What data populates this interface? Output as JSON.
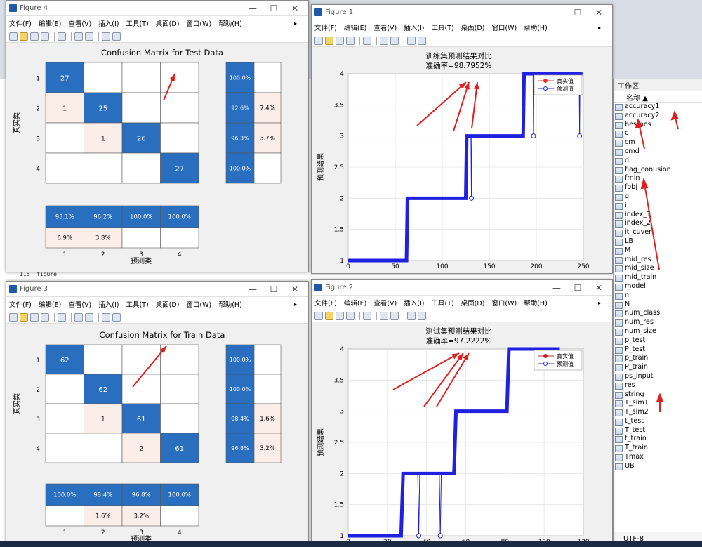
{
  "menu_cn": [
    "文件(F)",
    "编辑(E)",
    "查看(V)",
    "插入(I)",
    "工具(T)",
    "桌面(D)",
    "窗口(W)",
    "帮助(H)"
  ],
  "fig4": {
    "title": "Figure 4",
    "heading": "Confusion Matrix for Test Data",
    "ylabel": "真实类",
    "xlabel": "预测类",
    "rows": [
      "1",
      "2",
      "3",
      "4"
    ],
    "cols": [
      "1",
      "2",
      "3",
      "4"
    ],
    "cells": [
      [
        "27",
        "",
        "",
        ""
      ],
      [
        "1",
        "25",
        "",
        ""
      ],
      [
        "",
        "1",
        "26",
        ""
      ],
      [
        "",
        "",
        "",
        "27"
      ]
    ],
    "row_summary": [
      [
        "100.0%",
        ""
      ],
      [
        "92.6%",
        "7.4%"
      ],
      [
        "96.3%",
        "3.7%"
      ],
      [
        "100.0%",
        ""
      ]
    ],
    "col_summary_top": [
      "93.1%",
      "96.2%",
      "100.0%",
      "100.0%"
    ],
    "col_summary_bot": [
      "6.9%",
      "3.8%",
      "",
      ""
    ]
  },
  "fig3": {
    "title": "Figure 3",
    "heading": "Confusion Matrix for Train Data",
    "ylabel": "真实类",
    "xlabel": "预测类",
    "rows": [
      "1",
      "2",
      "3",
      "4"
    ],
    "cols": [
      "1",
      "2",
      "3",
      "4"
    ],
    "cells": [
      [
        "62",
        "",
        "",
        ""
      ],
      [
        "",
        "62",
        "",
        ""
      ],
      [
        "",
        "1",
        "61",
        ""
      ],
      [
        "",
        "",
        "2",
        "61"
      ]
    ],
    "row_summary": [
      [
        "100.0%",
        ""
      ],
      [
        "100.0%",
        ""
      ],
      [
        "98.4%",
        "1.6%"
      ],
      [
        "96.8%",
        "3.2%"
      ]
    ],
    "col_summary_top": [
      "100.0%",
      "98.4%",
      "96.8%",
      "100.0%"
    ],
    "col_summary_bot": [
      "",
      "1.6%",
      "3.2%",
      ""
    ]
  },
  "fig1": {
    "title": "Figure 1",
    "chart_data": {
      "type": "line",
      "title": "训练集预测结果对比",
      "subtitle": "准确率=98.7952%",
      "ylabel": "预测结果",
      "xlim": [
        0,
        250
      ],
      "ylim": [
        1,
        4
      ],
      "xticks": [
        0,
        50,
        100,
        150,
        200,
        250
      ],
      "yticks": [
        1,
        1.5,
        2,
        2.5,
        3,
        3.5,
        4
      ],
      "series": [
        {
          "name": "真实值",
          "color": "#e83030",
          "segments": [
            [
              0,
              62,
              1
            ],
            [
              63,
              125,
              2
            ],
            [
              126,
              186,
              3
            ],
            [
              187,
              249,
              4
            ]
          ]
        },
        {
          "name": "预测值",
          "color": "#2020e0",
          "segments": [
            [
              0,
              62,
              1
            ],
            [
              63,
              125,
              2
            ],
            [
              126,
              186,
              3
            ],
            [
              187,
              249,
              4
            ]
          ],
          "outliers": [
            [
              131,
              2
            ],
            [
              197,
              3
            ],
            [
              246,
              3
            ]
          ]
        }
      ]
    }
  },
  "fig2": {
    "title": "Figure 2",
    "menu": [
      "文件(F)",
      "编辑(E)",
      "查看(V)",
      "插入(I)",
      "工具(T)",
      "桌面(D)",
      "窗口(W)",
      "帮助(H)"
    ],
    "chart_data": {
      "type": "line",
      "title": "测试集预测结果对比",
      "subtitle": "准确率=97.2222%",
      "ylabel": "预测结果",
      "xlim": [
        0,
        120
      ],
      "ylim": [
        1,
        4
      ],
      "xticks": [
        0,
        20,
        40,
        60,
        80,
        100,
        120
      ],
      "yticks": [
        1,
        1.5,
        2,
        2.5,
        3,
        3.5,
        4
      ],
      "series": [
        {
          "name": "真实值",
          "color": "#c02828",
          "segments": [
            [
              0,
              27,
              1
            ],
            [
              28,
              54,
              2
            ],
            [
              55,
              81,
              3
            ],
            [
              82,
              108,
              4
            ]
          ]
        },
        {
          "name": "预测值",
          "color": "#2020e0",
          "segments": [
            [
              0,
              27,
              1
            ],
            [
              28,
              54,
              2
            ],
            [
              55,
              81,
              3
            ],
            [
              82,
              108,
              4
            ]
          ],
          "outliers": [
            [
              36,
              1
            ],
            [
              47,
              1
            ]
          ]
        }
      ]
    }
  },
  "workspace": {
    "header": "工作区",
    "col": "名称 ▲",
    "vars": [
      "accuracy1",
      "accuracy2",
      "bestpos",
      "c",
      "cm",
      "cmd",
      "d",
      "flag_conusion",
      "fmin",
      "fobj",
      "g",
      "i",
      "index_1",
      "index_2",
      "it_cuver",
      "LB",
      "M",
      "mid_res",
      "mid_size",
      "mid_train",
      "model",
      "n",
      "N",
      "num_class",
      "num_res",
      "num_size",
      "p_test",
      "P_test",
      "p_train",
      "P_train",
      "ps_input",
      "res",
      "string",
      "T_sim1",
      "T_sim2",
      "t_test",
      "T_test",
      "t_train",
      "T_train",
      "Tmax",
      "UB"
    ],
    "encoding": "UTF-8"
  },
  "code_line": {
    "num": "115",
    "text": "figure"
  },
  "colors": {
    "dark": "#2a6ebf",
    "light": "#fbeee8",
    "annot": "#e02020"
  }
}
